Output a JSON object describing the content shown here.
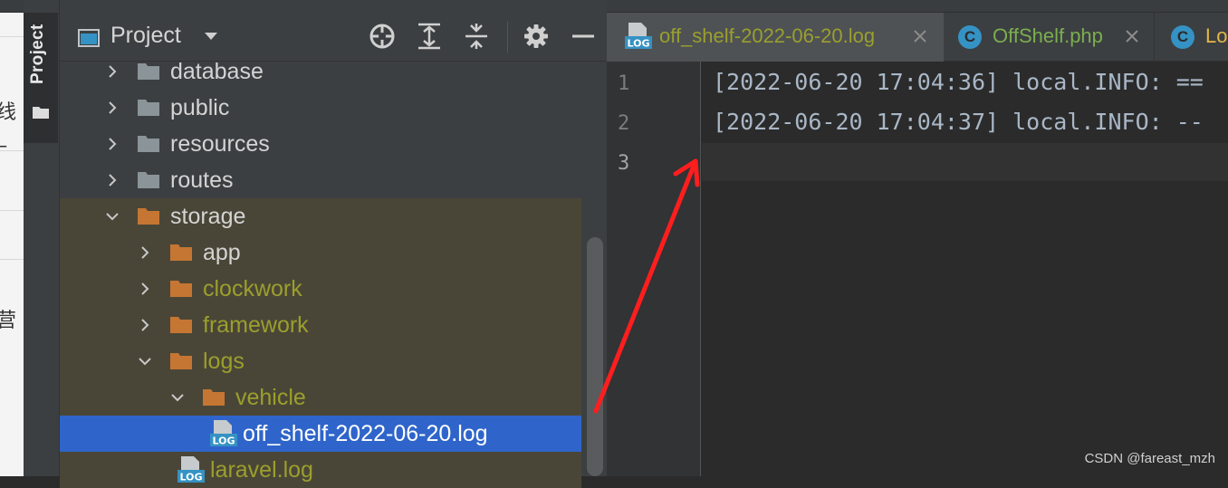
{
  "external_strip": {
    "chars": [
      "线_",
      "营"
    ]
  },
  "tool_strip": {
    "label": "Project"
  },
  "project_panel": {
    "title": "Project",
    "toolbar_icons": [
      "locate-icon",
      "expand-all-icon",
      "collapse-all-icon",
      "gear-icon",
      "minimize-icon"
    ]
  },
  "tree": [
    {
      "label": "database",
      "type": "folder",
      "expanded": false,
      "depth": 0
    },
    {
      "label": "public",
      "type": "folder",
      "expanded": false,
      "depth": 0
    },
    {
      "label": "resources",
      "type": "folder",
      "expanded": false,
      "depth": 0
    },
    {
      "label": "routes",
      "type": "folder",
      "expanded": false,
      "depth": 0
    },
    {
      "label": "storage",
      "type": "folder",
      "expanded": true,
      "depth": 0
    },
    {
      "label": "app",
      "type": "folder",
      "expanded": false,
      "depth": 1
    },
    {
      "label": "clockwork",
      "type": "folder",
      "expanded": false,
      "depth": 1
    },
    {
      "label": "framework",
      "type": "folder",
      "expanded": false,
      "depth": 1
    },
    {
      "label": "logs",
      "type": "folder",
      "expanded": true,
      "depth": 1
    },
    {
      "label": "vehicle",
      "type": "folder",
      "expanded": true,
      "depth": 2
    },
    {
      "label": "off_shelf-2022-06-20.log",
      "type": "log-file",
      "selected": true,
      "depth": 3
    },
    {
      "label": "laravel.log",
      "type": "log-file",
      "depth": 2
    }
  ],
  "editor": {
    "tabs": [
      {
        "label": "off_shelf-2022-06-20.log",
        "icon": "log-file-icon",
        "active": true
      },
      {
        "label": "OffShelf.php",
        "icon": "class-icon",
        "active": false
      },
      {
        "label": "Lo",
        "icon": "class-icon",
        "active": false
      }
    ],
    "line_numbers": [
      "1",
      "2",
      "3"
    ],
    "lines": [
      "[2022-06-20 17:04:36] local.INFO: ==",
      "[2022-06-20 17:04:37] local.INFO: --",
      ""
    ]
  },
  "watermark": "CSDN @fareast_mzh",
  "colors": {
    "background": "#2b2b2b",
    "panel": "#3c3f41",
    "selection": "#2f65ca",
    "folder_orange": "#c57633",
    "folder_gray": "#8a9499",
    "olive_text": "#9b9f2d",
    "annotation_arrow": "#ff1e1e"
  }
}
